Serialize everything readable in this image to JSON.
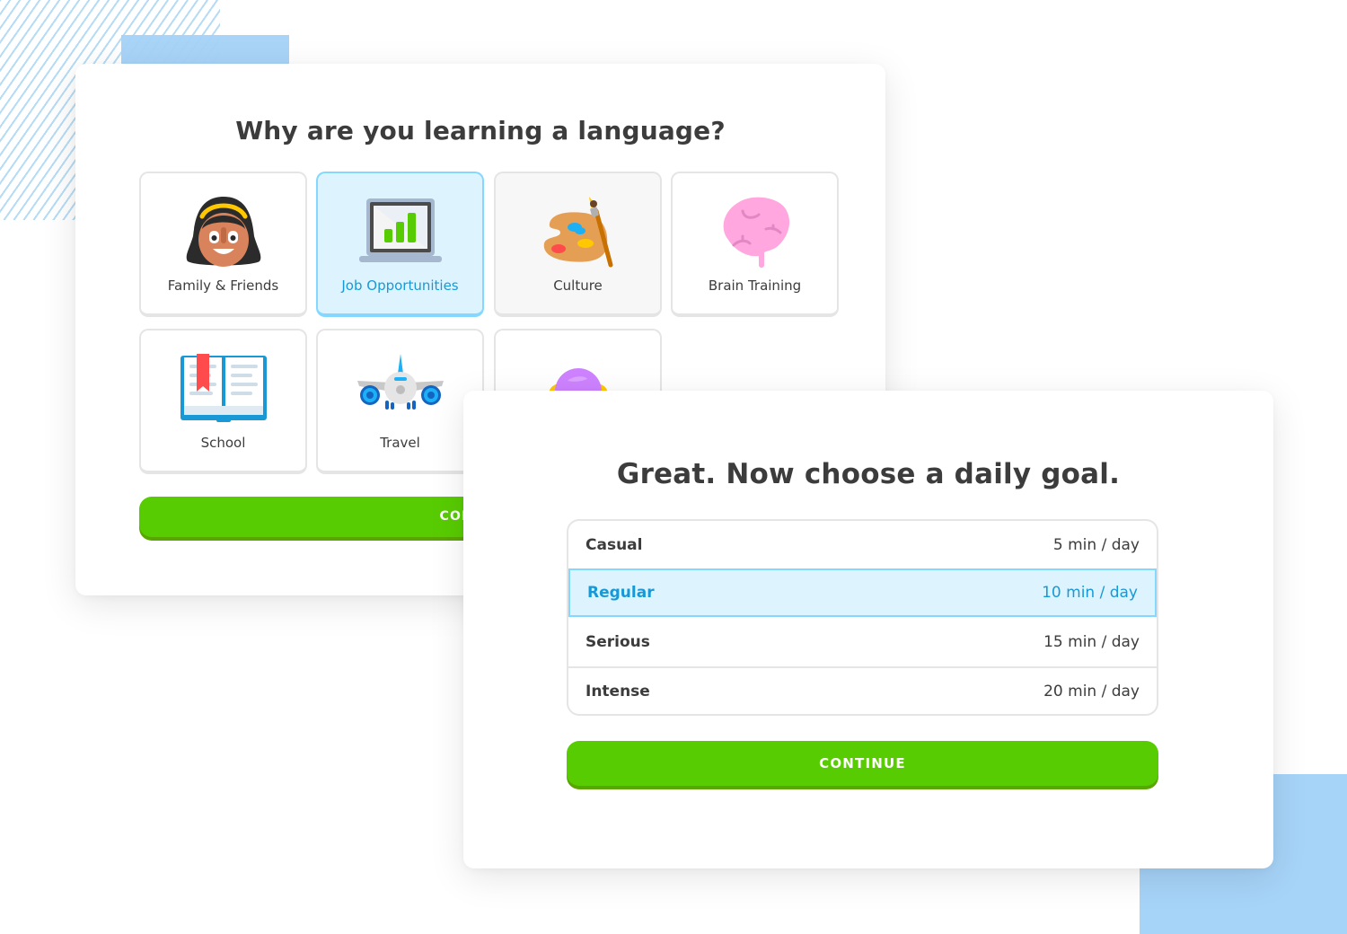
{
  "screen1": {
    "title": "Why are you learning a language?",
    "reasons": [
      {
        "label": "Family & Friends",
        "icon": "girl-face-icon",
        "state": "default"
      },
      {
        "label": "Job Opportunities",
        "icon": "laptop-chart-icon",
        "state": "selected"
      },
      {
        "label": "Culture",
        "icon": "paint-palette-icon",
        "state": "hover"
      },
      {
        "label": "Brain Training",
        "icon": "brain-icon",
        "state": "default"
      },
      {
        "label": "School",
        "icon": "open-book-icon",
        "state": "default"
      },
      {
        "label": "Travel",
        "icon": "airplane-icon",
        "state": "default"
      },
      {
        "label": "",
        "icon": "purple-planet-icon",
        "state": "default"
      }
    ],
    "continue_label": "CONTINUE"
  },
  "screen2": {
    "title": "Great. Now choose a daily goal.",
    "goals": [
      {
        "name": "Casual",
        "time": "5 min / day",
        "selected": false
      },
      {
        "name": "Regular",
        "time": "10 min / day",
        "selected": true
      },
      {
        "name": "Serious",
        "time": "15 min / day",
        "selected": false
      },
      {
        "name": "Intense",
        "time": "20 min / day",
        "selected": false
      }
    ],
    "continue_label": "CONTINUE"
  },
  "colors": {
    "accent_green": "#58cc02",
    "selected_blue": "#1899d6",
    "selected_bg": "#ddf4ff",
    "selected_border": "#84d8ff",
    "decor_blue": "#a6d3f8"
  }
}
